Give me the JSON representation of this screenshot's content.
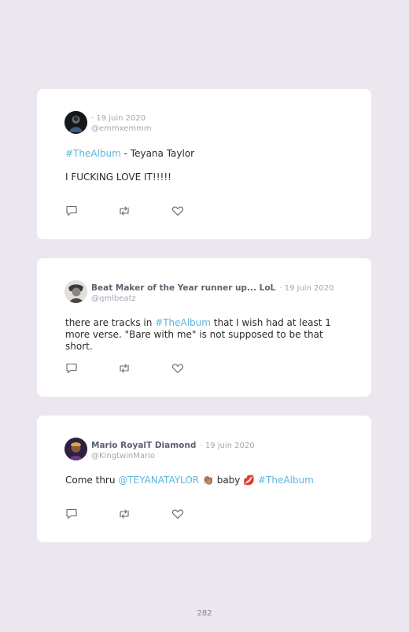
{
  "tweets": [
    {
      "name": "",
      "date": "· 19 juin 2020",
      "handle": "@emmxemmm",
      "line1_tag": "#TheAlbum",
      "line1_text": " - Teyana Taylor",
      "line2": "I FUCKING LOVE IT!!!!!"
    },
    {
      "name": "Beat Maker of the Year runner up... LoL",
      "date": "· 19 juin 2020",
      "handle": "@qmlbeatz",
      "text_a": "there are tracks in ",
      "tag": "#TheAlbum",
      "text_b": " that I wish had at least 1 more verse. \"Bare with me\" is not supposed to be that short."
    },
    {
      "name": "Mario RoyalT Diamond",
      "date": "· 19 juin 2020",
      "handle": "@KingtwinMario",
      "text_a": "Come thru ",
      "mention": "@TEYANATAYLOR",
      "emoji1": "👏🏽",
      "text_b": " baby ",
      "emoji2": "💋",
      "tag": "#TheAlbum"
    }
  ],
  "icons": [
    "reply-icon",
    "retweet-icon",
    "like-icon"
  ],
  "colors": {
    "background": "#ece7ee",
    "card": "#ffffff",
    "link": "#5eb6dd",
    "muted": "#a4a7ae"
  },
  "page_number": "282"
}
